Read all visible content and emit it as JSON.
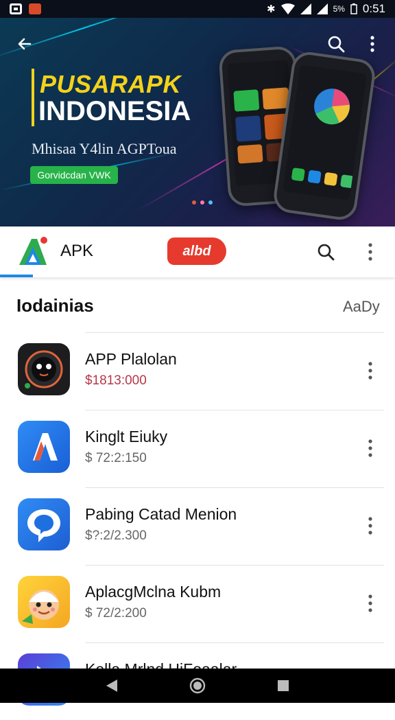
{
  "status_bar": {
    "time": "0:51",
    "battery": "5%"
  },
  "hero": {
    "title_line1": "PUSARAPK",
    "title_line2": "INDONESIA",
    "subtitle": "Mhisaa Y4lin AGPToua",
    "pill": "Gorvidcdan VWK",
    "colors": {
      "title1": "#f3d21b",
      "pill": "#27b34a"
    }
  },
  "appbar": {
    "name": "APK",
    "badge": "albd",
    "accent": "#1e88e5",
    "badge_color": "#e63a2e"
  },
  "section": {
    "title": "Iodainias",
    "action": "AaDy"
  },
  "apps": [
    {
      "title": "APP Plalolan",
      "price": "$1813:000",
      "icon": "camera-lens-icon",
      "price_color": "#b6364a"
    },
    {
      "title": "Kinglt Eiuky",
      "price": "$ 72:2:150",
      "icon": "letter-a-icon",
      "price_color": "#666666"
    },
    {
      "title": "Pabing Catad Menion",
      "price": "$?:2/2.300",
      "icon": "chat-bubble-icon",
      "price_color": "#666666"
    },
    {
      "title": "AplacgMclna Kubm",
      "price": "$ 72/2:200",
      "icon": "cartoon-face-icon",
      "price_color": "#666666"
    },
    {
      "title": "Kella Mrlnd HiFoaalar",
      "price": "",
      "icon": "play-icon",
      "price_color": "#666666"
    }
  ]
}
